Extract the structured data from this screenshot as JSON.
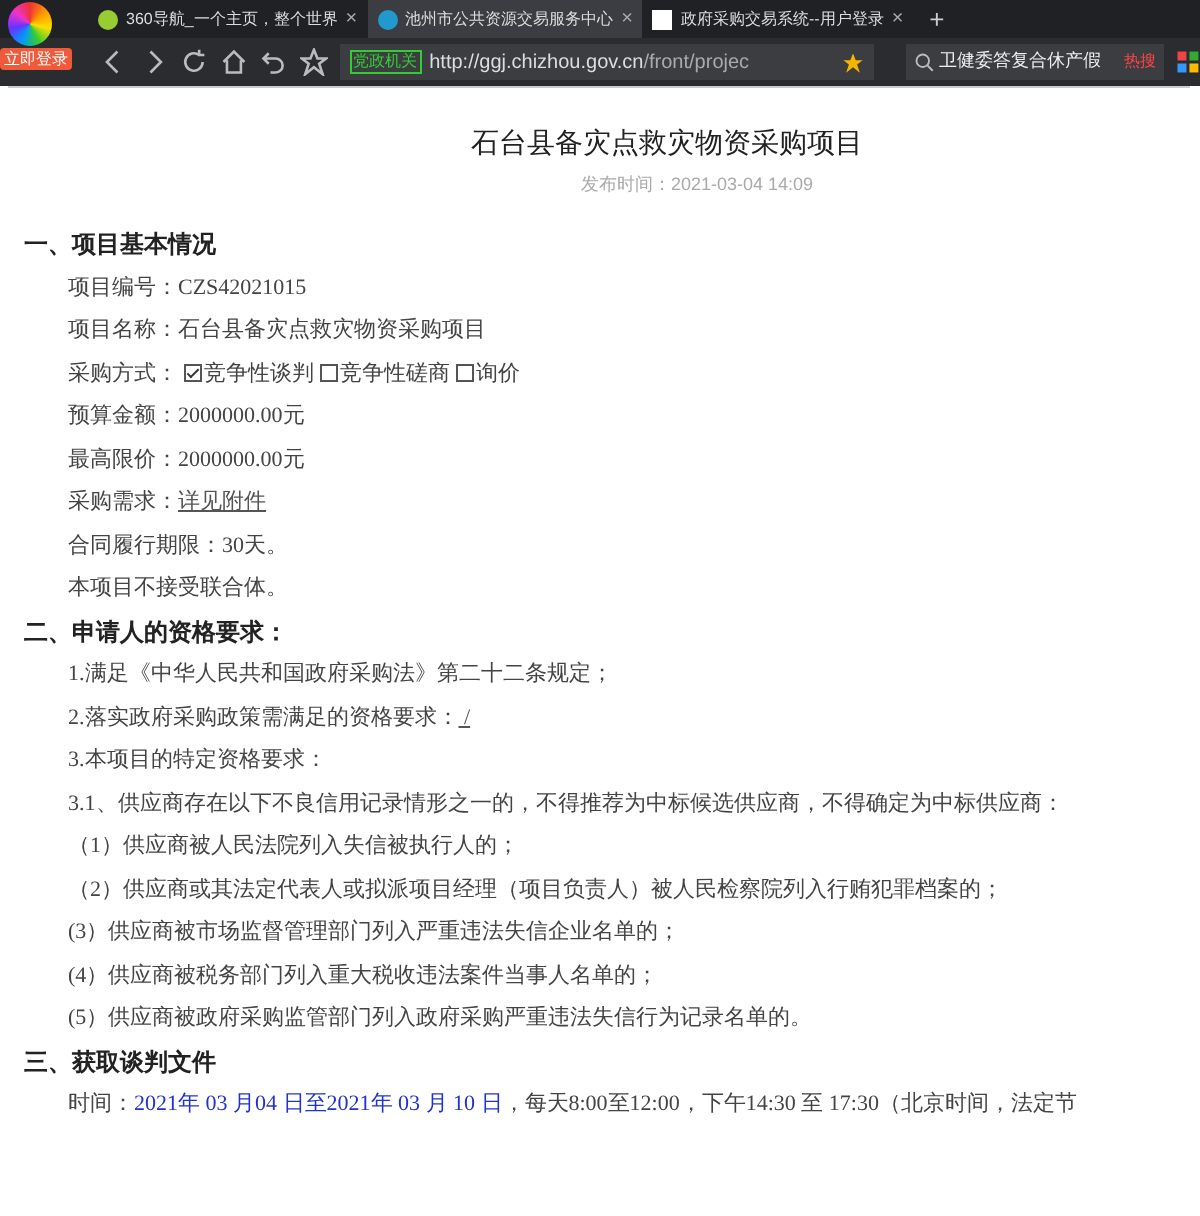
{
  "browser": {
    "login_button": "立即登录",
    "tabs": [
      {
        "title": "360导航_一个主页，整个世界",
        "close": "×",
        "selected": false
      },
      {
        "title": "池州市公共资源交易服务中心",
        "close": "×",
        "selected": true
      },
      {
        "title": "政府采购交易系统--用户登录",
        "close": "×",
        "selected": false
      }
    ],
    "new_tab": "+",
    "address": {
      "badge": "党政机关",
      "url_host": "http://ggj.chizhou.gov.cn",
      "url_path": "/front/projec"
    },
    "search": {
      "value": "卫健委答复合休产假",
      "badge": "热搜"
    }
  },
  "document": {
    "title": "石台县备灾点救灾物资采购项目",
    "published": "发布时间：2021-03-04 14:09",
    "sections": [
      {
        "heading": "一、项目基本情况",
        "lines": [
          {
            "kind": "text",
            "text": "项目编号：CZS42021015"
          },
          {
            "kind": "text",
            "text": "项目名称：石台县备灾点救灾物资采购项目"
          },
          {
            "kind": "options",
            "label": "采购方式：",
            "options": [
              {
                "text": "竞争性谈判",
                "checked": true
              },
              {
                "text": "竞争性磋商",
                "checked": false
              },
              {
                "text": "询价",
                "checked": false
              }
            ]
          },
          {
            "kind": "text",
            "text": "预算金额：2000000.00元"
          },
          {
            "kind": "text",
            "text": "最高限价：2000000.00元"
          },
          {
            "kind": "link",
            "label": "采购需求：",
            "link": "详见附件"
          },
          {
            "kind": "text",
            "text": "合同履行期限：30天。"
          },
          {
            "kind": "text",
            "text": "本项目不接受联合体。"
          }
        ]
      },
      {
        "heading": "二、申请人的资格要求：",
        "lines": [
          {
            "kind": "text",
            "text": "1.满足《中华人民共和国政府采购法》第二十二条规定；"
          },
          {
            "kind": "link",
            "label": "2.落实政府采购政策需满足的资格要求：",
            "link": " / "
          },
          {
            "kind": "text",
            "text": "3.本项目的特定资格要求："
          },
          {
            "kind": "text",
            "text": "3.1、供应商存在以下不良信用记录情形之一的，不得推荐为中标候选供应商，不得确定为中标供应商："
          },
          {
            "kind": "text",
            "text": "（1）供应商被人民法院列入失信被执行人的；"
          },
          {
            "kind": "text",
            "text": "（2）供应商或其法定代表人或拟派项目经理（项目负责人）被人民检察院列入行贿犯罪档案的；"
          },
          {
            "kind": "text",
            "text": "(3）供应商被市场监督管理部门列入严重违法失信企业名单的；"
          },
          {
            "kind": "text",
            "text": "(4）供应商被税务部门列入重大税收违法案件当事人名单的；"
          },
          {
            "kind": "text",
            "text": "(5）供应商被政府采购监管部门列入政府采购严重违法失信行为记录名单的。"
          }
        ]
      },
      {
        "heading": "三、获取谈判文件",
        "lines": [
          {
            "kind": "parts",
            "parts": [
              {
                "text": "时间：",
                "highlight": false
              },
              {
                "text": "2021年 03 月04 日至2021年 03 月 10 日",
                "highlight": true
              },
              {
                "text": "，每天8:00至12:00，下午14:30 至 17:30（北京时间，法定节",
                "highlight": false
              }
            ]
          }
        ]
      }
    ]
  }
}
